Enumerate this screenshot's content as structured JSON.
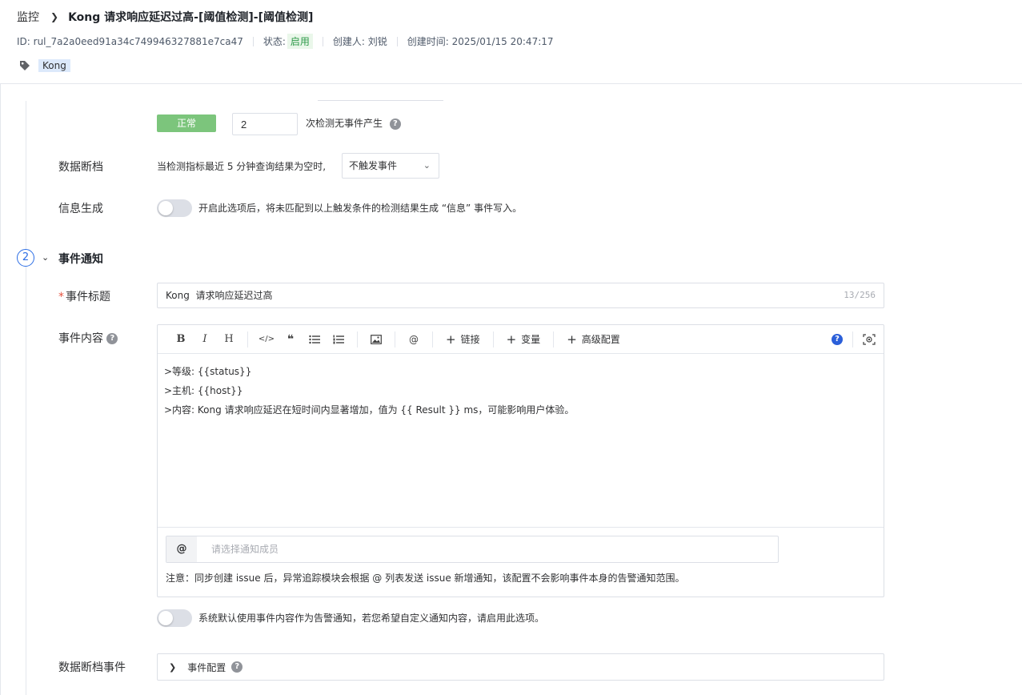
{
  "header": {
    "breadcrumb_root": "监控",
    "title": "Kong 请求响应延迟过高-[阈值检测]-[阈值检测]",
    "id_text": "ID: rul_7a2a0eed91a34c749946327881e7ca47",
    "status_label": "状态:",
    "status_value": "启用",
    "creator": "创建人: 刘锐",
    "created_at": "创建时间: 2025/01/15 20:47:17",
    "tag": "Kong"
  },
  "trigger": {
    "normal_label": "正常",
    "count_value": "2",
    "count_suffix": "次检测无事件产生"
  },
  "data_gap": {
    "label": "数据断档",
    "desc": "当检测指标最近 5 分钟查询结果为空时,",
    "select_value": "不触发事件"
  },
  "info_gen": {
    "label": "信息生成",
    "desc": "开启此选项后，将未匹配到以上触发条件的检测结果生成 “信息” 事件写入。"
  },
  "step": {
    "number": "2",
    "title": "事件通知"
  },
  "event_title": {
    "required_mark": "*",
    "label": "事件标题",
    "value": "Kong  请求响应延迟过高",
    "counter": "13/256"
  },
  "event_content": {
    "label": "事件内容",
    "toolbar": {
      "bold": "B",
      "italic": "I",
      "heading": "H",
      "code": "</>",
      "quote": "❝",
      "at": "@",
      "link": "链接",
      "variable": "变量",
      "advanced": "高级配置"
    },
    "lines": [
      ">等级: {{status}}",
      ">主机: {{host}}",
      ">内容: Kong 请求响应延迟在短时间内显著增加，值为 {{ Result }} ms，可能影响用户体验。"
    ],
    "member_at": "@",
    "member_placeholder": "请选择通知成员",
    "note": "注意：同步创建 issue 后，异常追踪模块会根据 @ 列表发送 issue 新增通知，该配置不会影响事件本身的告警通知范围。"
  },
  "custom_notice": {
    "desc": "系统默认使用事件内容作为告警通知，若您希望自定义通知内容，请启用此选项。"
  },
  "gap_event": {
    "label": "数据断档事件",
    "config_label": "事件配置"
  }
}
